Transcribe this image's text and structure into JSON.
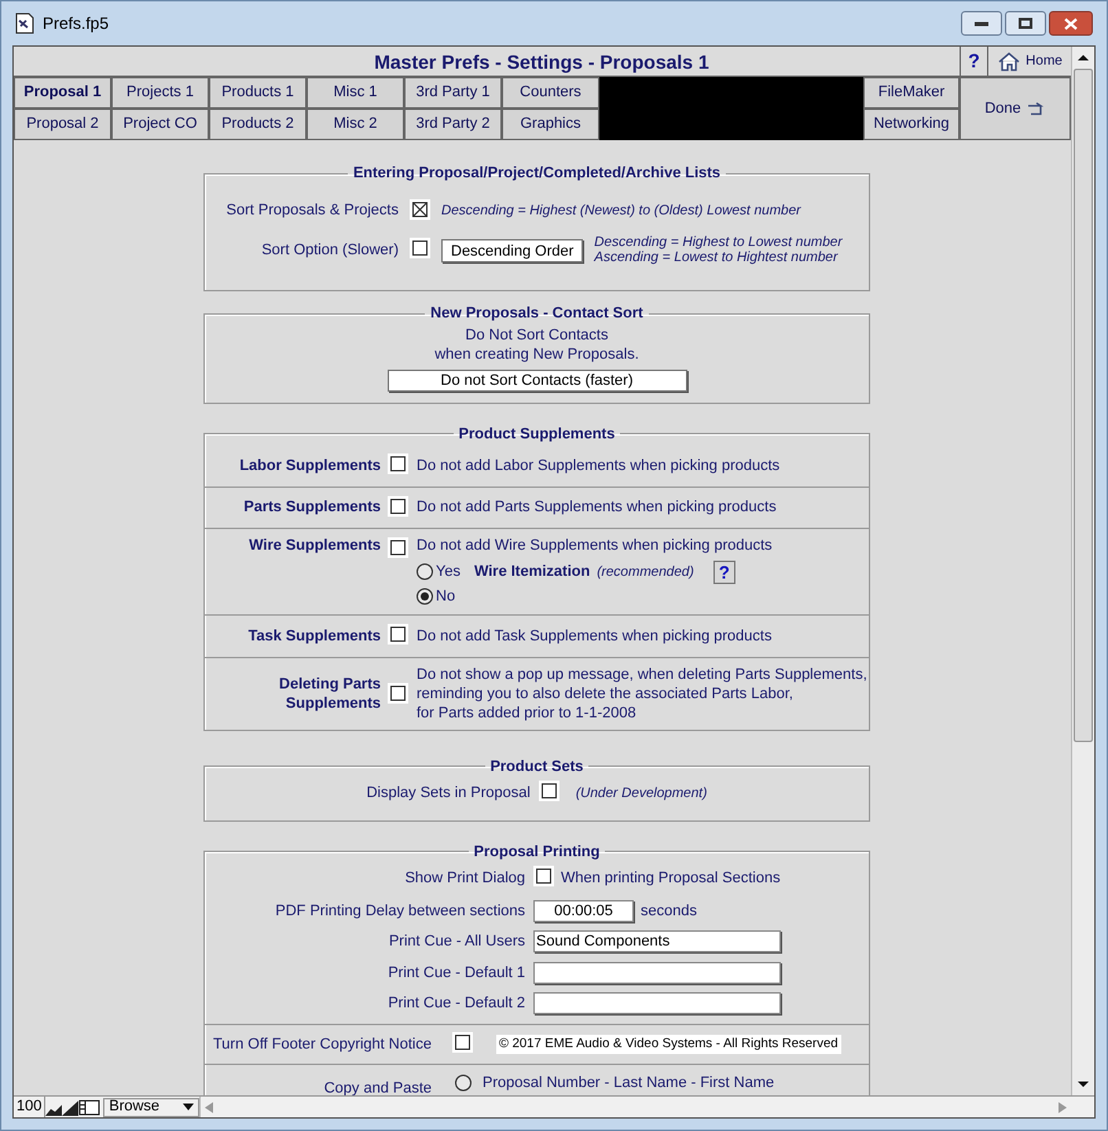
{
  "window": {
    "title": "Prefs.fp5"
  },
  "header": {
    "title": "Master Prefs - Settings - Proposals 1",
    "help": "?",
    "home": "Home"
  },
  "tabs": [
    [
      {
        "label": "Proposal 1",
        "selected": true
      },
      {
        "label": "Projects 1",
        "selected": false
      },
      {
        "label": "Products 1",
        "selected": false
      },
      {
        "label": "Misc 1",
        "selected": false
      },
      {
        "label": "3rd Party 1",
        "selected": false
      },
      {
        "label": "Counters",
        "selected": false
      }
    ],
    [
      {
        "label": "Proposal 2",
        "selected": false
      },
      {
        "label": "Project CO",
        "selected": false
      },
      {
        "label": "Products 2",
        "selected": false
      },
      {
        "label": "Misc 2",
        "selected": false
      },
      {
        "label": "3rd Party 2",
        "selected": false
      },
      {
        "label": "Graphics",
        "selected": false
      }
    ]
  ],
  "right_tabs": [
    "FileMaker",
    "Networking"
  ],
  "done": "Done",
  "lists_section": {
    "title": "Entering Proposal/Project/Completed/Archive Lists",
    "sort": {
      "label": "Sort Proposals & Projects",
      "checked": true,
      "note": "Descending = Highest (Newest) to (Oldest) Lowest number"
    },
    "option": {
      "label": "Sort Option (Slower)",
      "checked": false,
      "button": "Descending Order",
      "notes": [
        "Descending = Highest to Lowest number",
        "Ascending = Lowest to Hightest number"
      ]
    }
  },
  "contact_section": {
    "title": "New Proposals - Contact Sort",
    "lines": [
      "Do Not Sort Contacts",
      "when creating New Proposals."
    ],
    "button": "Do not Sort Contacts (faster)"
  },
  "supplements_section": {
    "title": "Product Supplements",
    "rows": [
      {
        "label": "Labor Supplements",
        "checked": false,
        "text": [
          "Do not add Labor Supplements when picking products"
        ]
      },
      {
        "label": "Parts Supplements",
        "checked": false,
        "text": [
          "Do not add Parts Supplements when picking products"
        ]
      },
      {
        "label": "Wire Supplements",
        "checked": false,
        "text": [
          "Do not add Wire Supplements when picking products"
        ],
        "itemization": {
          "options": [
            {
              "label": "Yes",
              "selected": false
            },
            {
              "label": "No",
              "selected": true
            }
          ],
          "title": "Wire Itemization",
          "note": "(recommended)",
          "help": "?"
        }
      },
      {
        "label": "Task Supplements",
        "checked": false,
        "text": [
          "Do not add Task Supplements when picking products"
        ]
      },
      {
        "label": "Deleting Parts Supplements",
        "checked": false,
        "text": [
          "Do not show a pop up message, when deleting Parts Supplements,",
          "reminding you to also delete the associated Parts Labor,",
          "for Parts added prior to 1-1-2008"
        ]
      }
    ]
  },
  "sets_section": {
    "title": "Product Sets",
    "label": "Display Sets in Proposal",
    "checked": false,
    "note": "(Under Development)"
  },
  "printing_section": {
    "title": "Proposal Printing",
    "dialog": {
      "label": "Show Print Dialog",
      "checked": false,
      "text": "When printing Proposal Sections"
    },
    "delay": {
      "label": "PDF Printing Delay between sections",
      "value": "00:00:05",
      "unit": "seconds"
    },
    "cues": [
      {
        "label": "Print Cue - All Users",
        "value": "Sound Components"
      },
      {
        "label": "Print Cue - Default 1"
      },
      {
        "label": "Print Cue - Default 2"
      }
    ],
    "footer": {
      "label": "Turn Off Footer Copyright Notice",
      "checked": false,
      "notice": "© 2017 EME Audio & Video Systems - All Rights Reserved"
    },
    "copy": {
      "label": "Copy and Paste",
      "options": [
        {
          "label": "Proposal Number - Last Name - First Name",
          "selected": false
        }
      ]
    }
  },
  "status_bar": {
    "zoom": "100",
    "mode": "Browse"
  }
}
